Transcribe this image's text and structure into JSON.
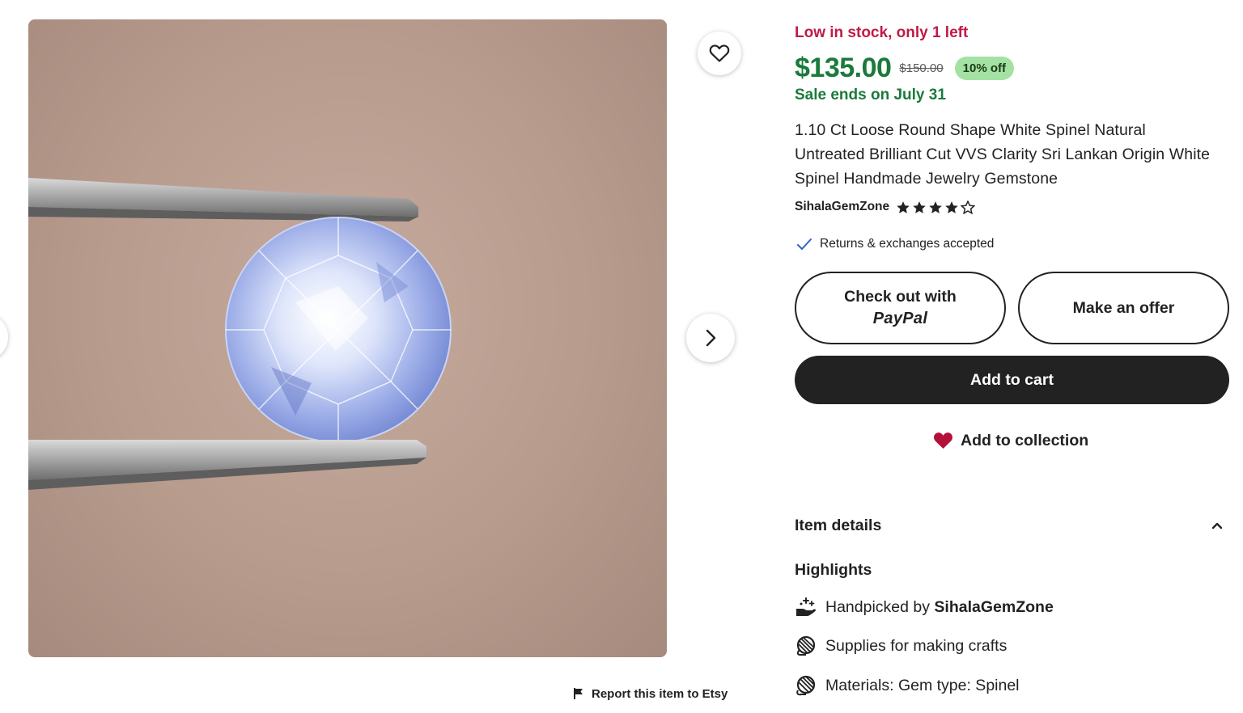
{
  "gallery": {
    "prev_icon": "chevron-left-icon",
    "next_icon": "chevron-right-icon",
    "favorite_icon": "heart-outline-icon"
  },
  "report": {
    "icon": "flag-icon",
    "label": "Report this item to Etsy"
  },
  "listing": {
    "stock_text": "Low in stock, only 1 left",
    "price": "$135.00",
    "original_price": "$150.00",
    "discount": "10% off",
    "sale_ends": "Sale ends on July 31",
    "title": "1.10 Ct Loose Round Shape White Spinel Natural Untreated Brilliant Cut VVS Clarity Sri Lankan Origin White Spinel Handmade Jewelry Gemstone",
    "shop_name": "SihalaGemZone",
    "rating": 4,
    "rating_max": 5,
    "returns": "Returns & exchanges accepted"
  },
  "actions": {
    "paypal_line1": "Check out with",
    "paypal_brand": "PayPal",
    "offer": "Make an offer",
    "cart": "Add to cart",
    "collection": "Add to collection"
  },
  "details": {
    "title": "Item details",
    "highlights_title": "Highlights",
    "highlights": [
      {
        "icon": "hand-sparkle-icon",
        "prefix": "Handpicked by ",
        "bold": "SihalaGemZone"
      },
      {
        "icon": "yarn-ball-icon",
        "prefix": "Supplies for making crafts",
        "bold": ""
      },
      {
        "icon": "material-icon",
        "prefix": "Materials: Gem type: Spinel",
        "bold": ""
      }
    ]
  },
  "colors": {
    "stock_red": "#c01a48",
    "sale_green": "#1a7a3b",
    "discount_bg": "#a3e2a2",
    "button_dark": "#222222",
    "heart_red": "#b3103a"
  }
}
